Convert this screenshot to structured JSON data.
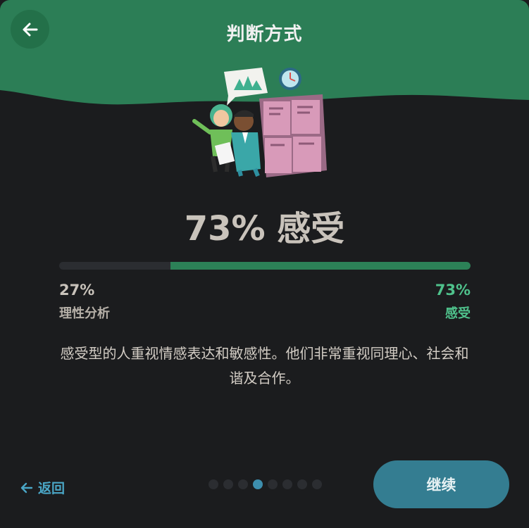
{
  "header": {
    "title": "判断方式",
    "back_icon": "arrow-left-icon",
    "color": "#2c7e56"
  },
  "result": {
    "headline": "73% 感受",
    "progress_fraction": 0.73,
    "left": {
      "percent": "27%",
      "label": "理性分析"
    },
    "right": {
      "percent": "73%",
      "label": "感受"
    },
    "description": "感受型的人重视情感表达和敏感性。他们非常重视同理心、社会和谐及合作。"
  },
  "footer": {
    "back_label": "返回",
    "back_icon": "arrow-left-icon",
    "continue_label": "继续",
    "page_dots": {
      "total": 8,
      "active_index": 3
    }
  },
  "colors": {
    "accent_green": "#2c8157",
    "accent_teal": "#347d91",
    "link_blue": "#4aa6c6",
    "background": "#1b1c1e"
  }
}
